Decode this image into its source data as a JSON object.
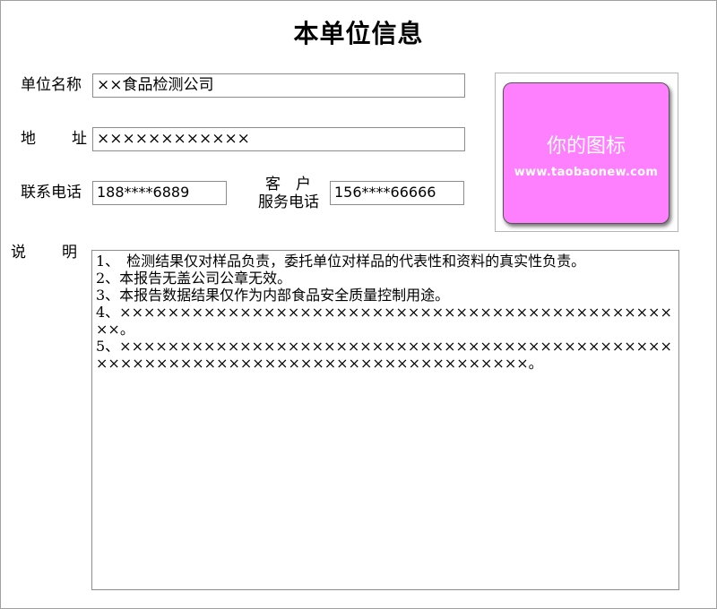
{
  "page": {
    "title": "本单位信息"
  },
  "form": {
    "company_name_label": "单位名称",
    "company_name_value": "××食品检测公司",
    "address_label_1": "地",
    "address_label_2": "址",
    "address_value": "××××××××××××",
    "phone_label": "联系电话",
    "phone_value": "188****6889",
    "service_label_1": "客　户",
    "service_label_2": "服务电话",
    "service_value": "156****66666",
    "notes_label_1": "说",
    "notes_label_2": "明"
  },
  "logo": {
    "text": "你的图标",
    "url": "www.taobaonew.com",
    "color": "#ff80ff"
  },
  "notes": {
    "lines": [
      "1、　检测结果仅对样品负责，委托单位对样品的代表性和资料的真实性负责。",
      "2、本报告无盖公司公章无效。",
      "3、本报告数据结果仅作为内部食品安全质量控制用途。",
      "4、××××××××××××××××××××××××××××××××××××××××××××××××。",
      "5、××××××××××××××××××××××××××××××××××××××××××××××××××××××××××××××××××××××××××××××××××。"
    ]
  }
}
